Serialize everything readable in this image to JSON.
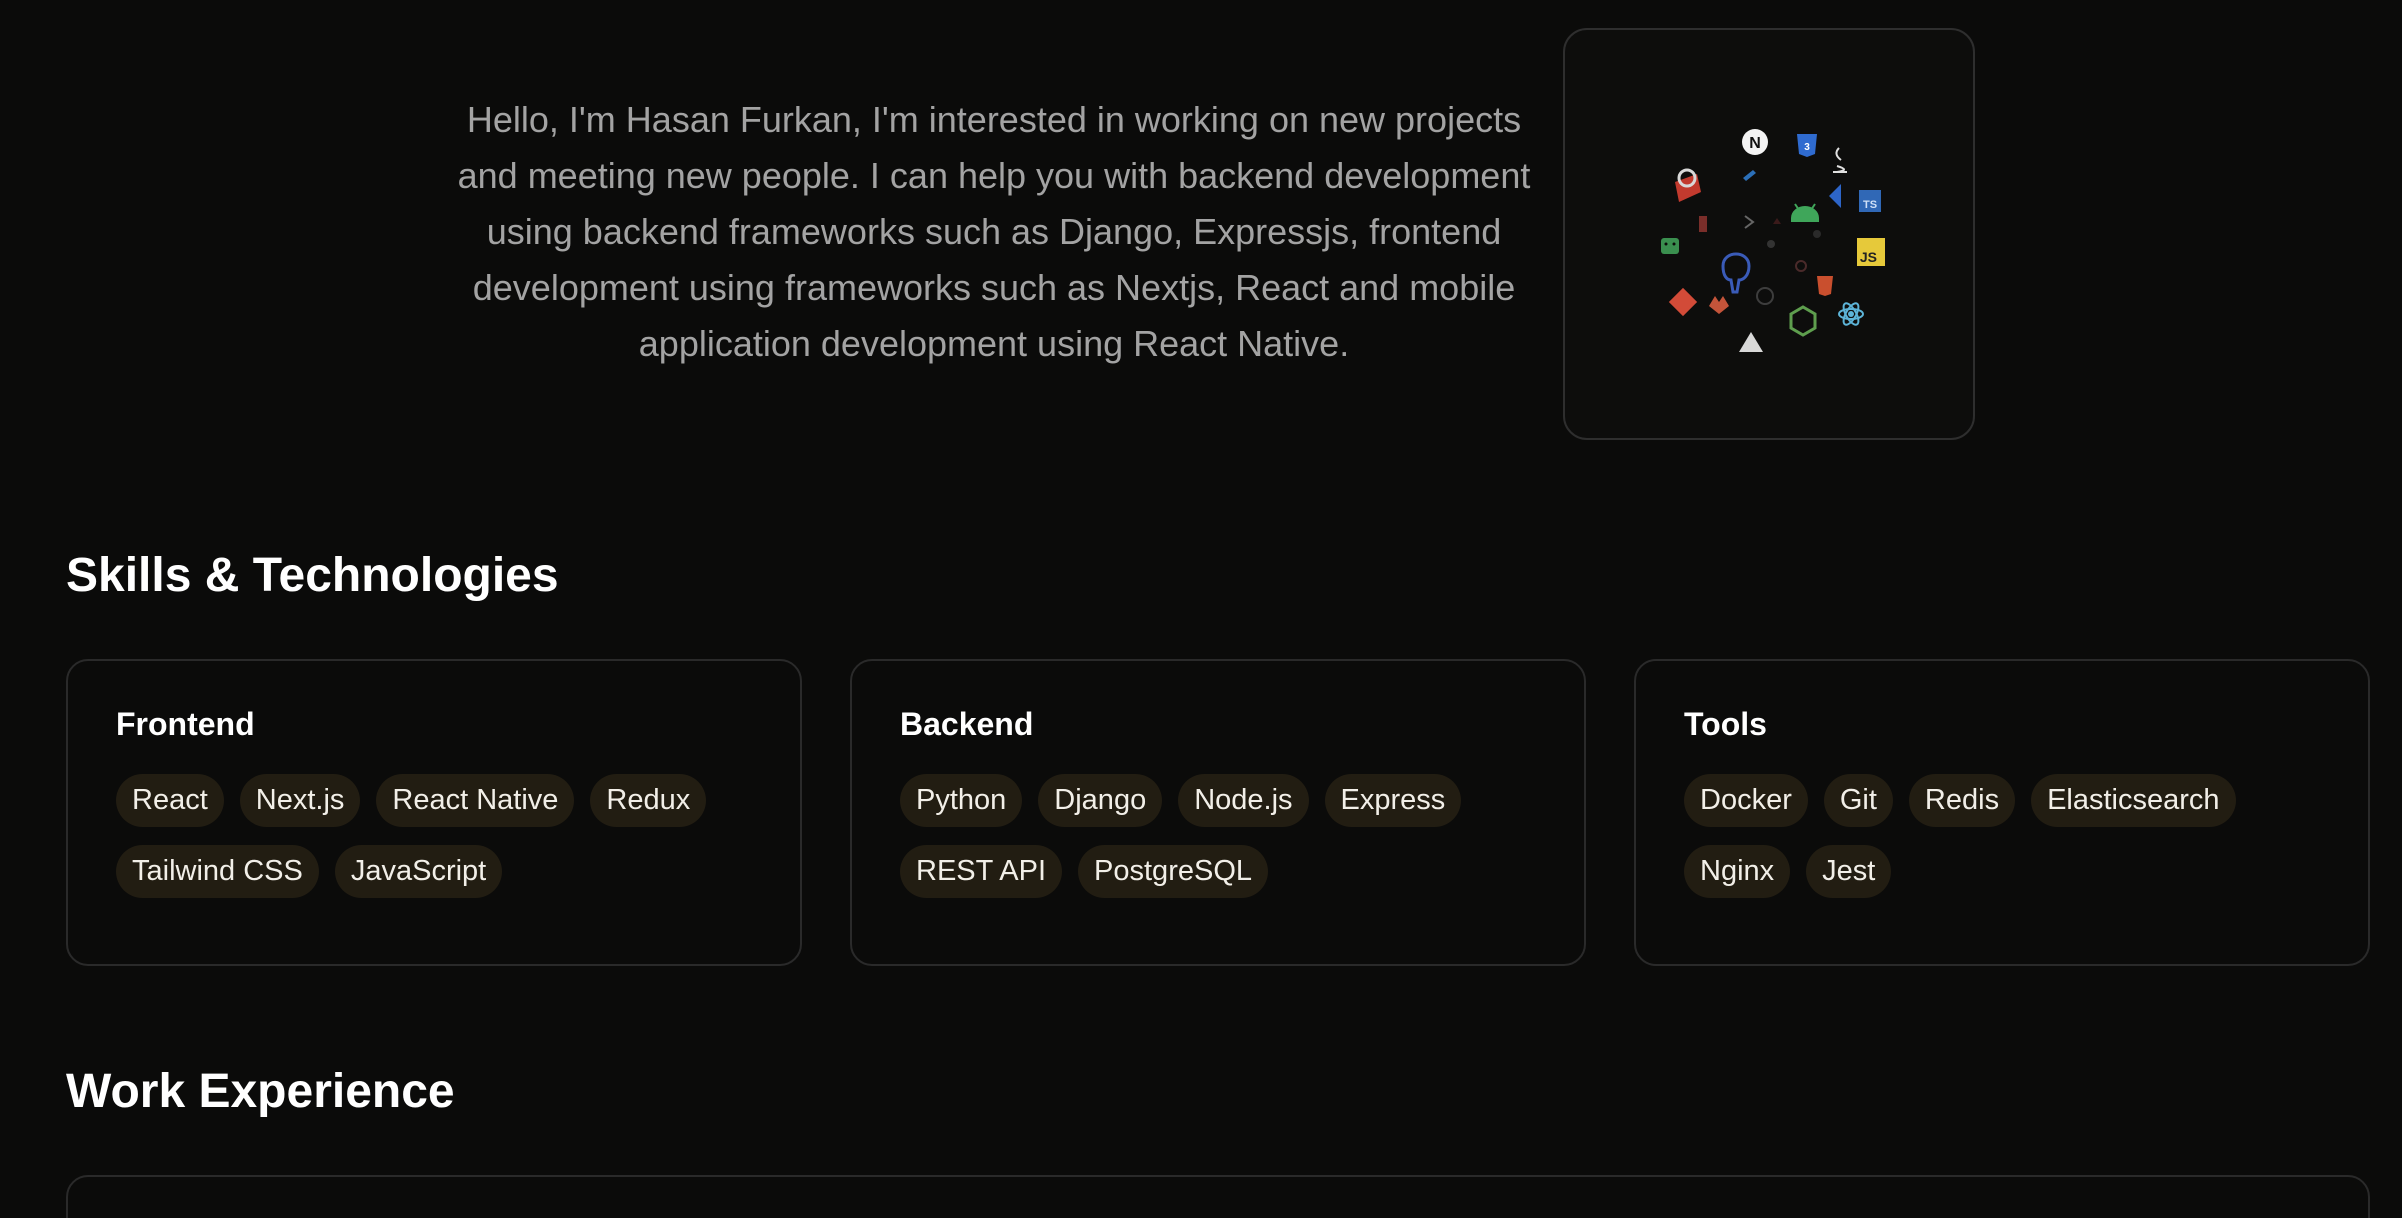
{
  "intro": {
    "text": "Hello, I'm Hasan Furkan, I'm interested in working on new projects and meeting new people. I can help you with backend development using backend frameworks such as Django, Expressjs, frontend development using frameworks such as Nextjs, React and mobile application development using React Native."
  },
  "tech_icons": [
    "nextjs-icon",
    "css3-icon",
    "java-icon",
    "typescript-icon",
    "javascript-icon",
    "android-icon",
    "html5-icon",
    "react-icon",
    "nodejs-icon",
    "vercel-icon",
    "gitlab-icon",
    "git-icon",
    "postgresql-icon",
    "redis-icon",
    "docker-icon",
    "flutter-icon",
    "android-alt-icon"
  ],
  "skills": {
    "title": "Skills & Technologies",
    "categories": [
      {
        "title": "Frontend",
        "items": [
          "React",
          "Next.js",
          "React Native",
          "Redux",
          "Tailwind CSS",
          "JavaScript"
        ]
      },
      {
        "title": "Backend",
        "items": [
          "Python",
          "Django",
          "Node.js",
          "Express",
          "REST API",
          "PostgreSQL"
        ]
      },
      {
        "title": "Tools",
        "items": [
          "Docker",
          "Git",
          "Redis",
          "Elasticsearch",
          "Nginx",
          "Jest"
        ]
      }
    ]
  },
  "work": {
    "title": "Work Experience"
  },
  "colors": {
    "background": "#0b0b0a",
    "chip_background": "#221d12",
    "card_border": "#2a2a2a",
    "muted_text": "#a3a3a3"
  }
}
